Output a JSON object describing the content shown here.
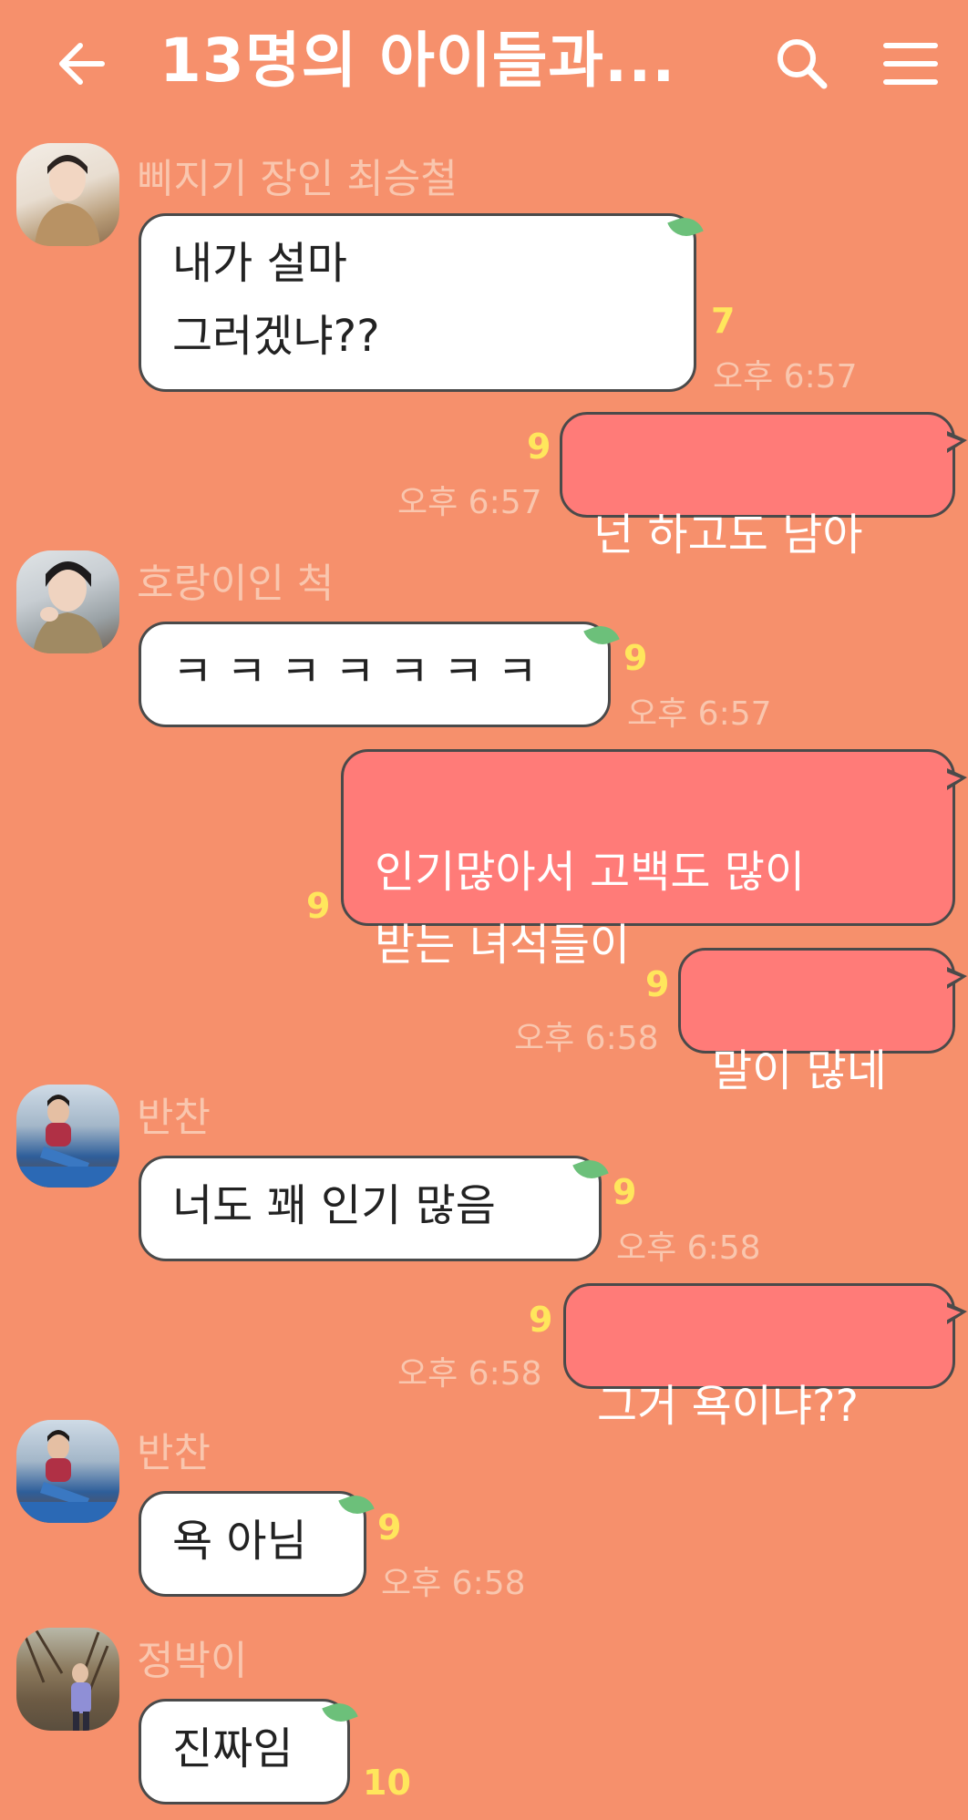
{
  "header": {
    "title": "13명의 아이들과...",
    "back_icon": "arrow-left-icon",
    "search_icon": "search-icon",
    "menu_icon": "hamburger-menu-icon"
  },
  "messages": [
    {
      "sender": "삐지기 장인 최승철",
      "text": "내가 설마\n그러겠냐??",
      "count": "7",
      "time": "오후 6:57",
      "dir": "in"
    },
    {
      "text": "넌 하고도 남아",
      "count": "9",
      "time": "오후 6:57",
      "dir": "out"
    },
    {
      "sender": "호랑이인 척",
      "text": "ㅋ ㅋ ㅋ ㅋ ㅋ ㅋ ㅋ",
      "count": "9",
      "time": "오후 6:57",
      "dir": "in"
    },
    {
      "text": "인기많아서 고백도 많이\n받는 녀석들이",
      "count": "9",
      "dir": "out"
    },
    {
      "text": "말이 많네",
      "count": "9",
      "time": "오후 6:58",
      "dir": "out"
    },
    {
      "sender": "반찬",
      "text": "너도 꽤 인기 많음",
      "count": "9",
      "time": "오후 6:58",
      "dir": "in"
    },
    {
      "text": "그거 욕이냐??",
      "count": "9",
      "time": "오후 6:58",
      "dir": "out"
    },
    {
      "sender": "반찬",
      "text": "욕 아님",
      "count": "9",
      "time": "오후 6:58",
      "dir": "in"
    },
    {
      "sender": "정박이",
      "text": "진짜임",
      "count": "10",
      "dir": "in"
    }
  ]
}
